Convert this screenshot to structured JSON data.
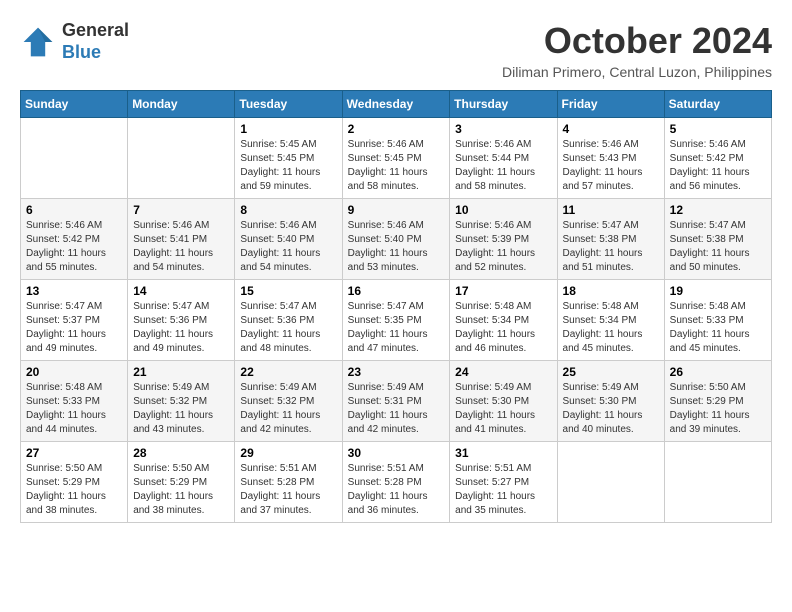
{
  "header": {
    "logo_general": "General",
    "logo_blue": "Blue",
    "month_year": "October 2024",
    "location": "Diliman Primero, Central Luzon, Philippines"
  },
  "weekdays": [
    "Sunday",
    "Monday",
    "Tuesday",
    "Wednesday",
    "Thursday",
    "Friday",
    "Saturday"
  ],
  "weeks": [
    [
      {
        "day": "",
        "sunrise": "",
        "sunset": "",
        "daylight": ""
      },
      {
        "day": "",
        "sunrise": "",
        "sunset": "",
        "daylight": ""
      },
      {
        "day": "1",
        "sunrise": "Sunrise: 5:45 AM",
        "sunset": "Sunset: 5:45 PM",
        "daylight": "Daylight: 11 hours and 59 minutes."
      },
      {
        "day": "2",
        "sunrise": "Sunrise: 5:46 AM",
        "sunset": "Sunset: 5:45 PM",
        "daylight": "Daylight: 11 hours and 58 minutes."
      },
      {
        "day": "3",
        "sunrise": "Sunrise: 5:46 AM",
        "sunset": "Sunset: 5:44 PM",
        "daylight": "Daylight: 11 hours and 58 minutes."
      },
      {
        "day": "4",
        "sunrise": "Sunrise: 5:46 AM",
        "sunset": "Sunset: 5:43 PM",
        "daylight": "Daylight: 11 hours and 57 minutes."
      },
      {
        "day": "5",
        "sunrise": "Sunrise: 5:46 AM",
        "sunset": "Sunset: 5:42 PM",
        "daylight": "Daylight: 11 hours and 56 minutes."
      }
    ],
    [
      {
        "day": "6",
        "sunrise": "Sunrise: 5:46 AM",
        "sunset": "Sunset: 5:42 PM",
        "daylight": "Daylight: 11 hours and 55 minutes."
      },
      {
        "day": "7",
        "sunrise": "Sunrise: 5:46 AM",
        "sunset": "Sunset: 5:41 PM",
        "daylight": "Daylight: 11 hours and 54 minutes."
      },
      {
        "day": "8",
        "sunrise": "Sunrise: 5:46 AM",
        "sunset": "Sunset: 5:40 PM",
        "daylight": "Daylight: 11 hours and 54 minutes."
      },
      {
        "day": "9",
        "sunrise": "Sunrise: 5:46 AM",
        "sunset": "Sunset: 5:40 PM",
        "daylight": "Daylight: 11 hours and 53 minutes."
      },
      {
        "day": "10",
        "sunrise": "Sunrise: 5:46 AM",
        "sunset": "Sunset: 5:39 PM",
        "daylight": "Daylight: 11 hours and 52 minutes."
      },
      {
        "day": "11",
        "sunrise": "Sunrise: 5:47 AM",
        "sunset": "Sunset: 5:38 PM",
        "daylight": "Daylight: 11 hours and 51 minutes."
      },
      {
        "day": "12",
        "sunrise": "Sunrise: 5:47 AM",
        "sunset": "Sunset: 5:38 PM",
        "daylight": "Daylight: 11 hours and 50 minutes."
      }
    ],
    [
      {
        "day": "13",
        "sunrise": "Sunrise: 5:47 AM",
        "sunset": "Sunset: 5:37 PM",
        "daylight": "Daylight: 11 hours and 49 minutes."
      },
      {
        "day": "14",
        "sunrise": "Sunrise: 5:47 AM",
        "sunset": "Sunset: 5:36 PM",
        "daylight": "Daylight: 11 hours and 49 minutes."
      },
      {
        "day": "15",
        "sunrise": "Sunrise: 5:47 AM",
        "sunset": "Sunset: 5:36 PM",
        "daylight": "Daylight: 11 hours and 48 minutes."
      },
      {
        "day": "16",
        "sunrise": "Sunrise: 5:47 AM",
        "sunset": "Sunset: 5:35 PM",
        "daylight": "Daylight: 11 hours and 47 minutes."
      },
      {
        "day": "17",
        "sunrise": "Sunrise: 5:48 AM",
        "sunset": "Sunset: 5:34 PM",
        "daylight": "Daylight: 11 hours and 46 minutes."
      },
      {
        "day": "18",
        "sunrise": "Sunrise: 5:48 AM",
        "sunset": "Sunset: 5:34 PM",
        "daylight": "Daylight: 11 hours and 45 minutes."
      },
      {
        "day": "19",
        "sunrise": "Sunrise: 5:48 AM",
        "sunset": "Sunset: 5:33 PM",
        "daylight": "Daylight: 11 hours and 45 minutes."
      }
    ],
    [
      {
        "day": "20",
        "sunrise": "Sunrise: 5:48 AM",
        "sunset": "Sunset: 5:33 PM",
        "daylight": "Daylight: 11 hours and 44 minutes."
      },
      {
        "day": "21",
        "sunrise": "Sunrise: 5:49 AM",
        "sunset": "Sunset: 5:32 PM",
        "daylight": "Daylight: 11 hours and 43 minutes."
      },
      {
        "day": "22",
        "sunrise": "Sunrise: 5:49 AM",
        "sunset": "Sunset: 5:32 PM",
        "daylight": "Daylight: 11 hours and 42 minutes."
      },
      {
        "day": "23",
        "sunrise": "Sunrise: 5:49 AM",
        "sunset": "Sunset: 5:31 PM",
        "daylight": "Daylight: 11 hours and 42 minutes."
      },
      {
        "day": "24",
        "sunrise": "Sunrise: 5:49 AM",
        "sunset": "Sunset: 5:30 PM",
        "daylight": "Daylight: 11 hours and 41 minutes."
      },
      {
        "day": "25",
        "sunrise": "Sunrise: 5:49 AM",
        "sunset": "Sunset: 5:30 PM",
        "daylight": "Daylight: 11 hours and 40 minutes."
      },
      {
        "day": "26",
        "sunrise": "Sunrise: 5:50 AM",
        "sunset": "Sunset: 5:29 PM",
        "daylight": "Daylight: 11 hours and 39 minutes."
      }
    ],
    [
      {
        "day": "27",
        "sunrise": "Sunrise: 5:50 AM",
        "sunset": "Sunset: 5:29 PM",
        "daylight": "Daylight: 11 hours and 38 minutes."
      },
      {
        "day": "28",
        "sunrise": "Sunrise: 5:50 AM",
        "sunset": "Sunset: 5:29 PM",
        "daylight": "Daylight: 11 hours and 38 minutes."
      },
      {
        "day": "29",
        "sunrise": "Sunrise: 5:51 AM",
        "sunset": "Sunset: 5:28 PM",
        "daylight": "Daylight: 11 hours and 37 minutes."
      },
      {
        "day": "30",
        "sunrise": "Sunrise: 5:51 AM",
        "sunset": "Sunset: 5:28 PM",
        "daylight": "Daylight: 11 hours and 36 minutes."
      },
      {
        "day": "31",
        "sunrise": "Sunrise: 5:51 AM",
        "sunset": "Sunset: 5:27 PM",
        "daylight": "Daylight: 11 hours and 35 minutes."
      },
      {
        "day": "",
        "sunrise": "",
        "sunset": "",
        "daylight": ""
      },
      {
        "day": "",
        "sunrise": "",
        "sunset": "",
        "daylight": ""
      }
    ]
  ]
}
